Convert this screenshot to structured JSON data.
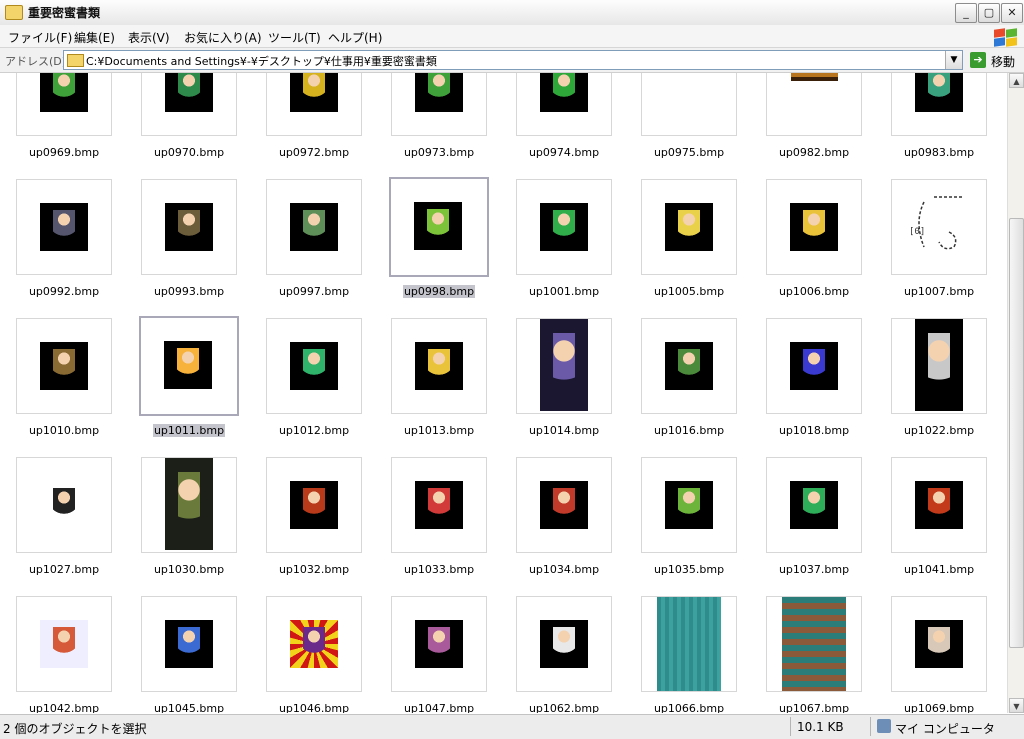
{
  "window": {
    "title": "重要密蜜書類",
    "buttons": {
      "minimize": "_",
      "maximize": "▢",
      "close": "✕"
    }
  },
  "menu": [
    "ファイル(F)",
    "編集(E)",
    "表示(V)",
    "お気に入り(A)",
    "ツール(T)",
    "ヘルプ(H)"
  ],
  "address": {
    "label": "アドレス(D)",
    "path": "C:¥Documents and Settings¥-¥デスクトップ¥仕事用¥重要密蜜書類",
    "go_label": "移動"
  },
  "files": [
    [
      "up0969.bmp",
      "up0970.bmp",
      "up0972.bmp",
      "up0973.bmp",
      "up0974.bmp",
      "up0975.bmp",
      "up0982.bmp",
      "up0983.bmp"
    ],
    [
      "up0992.bmp",
      "up0993.bmp",
      "up0997.bmp",
      "up0998.bmp",
      "up1001.bmp",
      "up1005.bmp",
      "up1006.bmp",
      "up1007.bmp"
    ],
    [
      "up1010.bmp",
      "up1011.bmp",
      "up1012.bmp",
      "up1013.bmp",
      "up1014.bmp",
      "up1016.bmp",
      "up1018.bmp",
      "up1022.bmp"
    ],
    [
      "up1027.bmp",
      "up1030.bmp",
      "up1032.bmp",
      "up1033.bmp",
      "up1034.bmp",
      "up1035.bmp",
      "up1037.bmp",
      "up1041.bmp"
    ],
    [
      "up1042.bmp",
      "up1045.bmp",
      "up1046.bmp",
      "up1047.bmp",
      "up1062.bmp",
      "up1066.bmp",
      "up1067.bmp",
      "up1069.bmp"
    ]
  ],
  "selected_files": [
    "up0998.bmp",
    "up1011.bmp"
  ],
  "status": {
    "selection": "2 個のオブジェクトを選択",
    "size": "10.1 KB",
    "location": "マイ コンピュータ"
  },
  "colors": {
    "selection_highlight": "#c4c4cc",
    "go_arrow": "#3a9b2f",
    "folder": "#f3d46b"
  }
}
